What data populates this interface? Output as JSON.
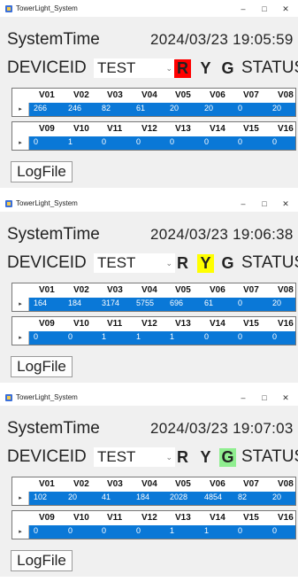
{
  "colors": {
    "red_on": "#ff0000",
    "yellow_on": "#ffff00",
    "green_on": "#90ee90",
    "off": "#f0f0f0",
    "grid_row": "#0a78d7"
  },
  "windows": [
    {
      "title": "TowerLight_System",
      "system_time_label": "SystemTime",
      "system_time_value": "2024/03/23  19:05:59",
      "device_id_label": "DEVICEID",
      "device_id_value": "TEST",
      "lights": {
        "r": "R",
        "y": "Y",
        "g": "G",
        "active": "R"
      },
      "status_label": "STATUS",
      "grid1": {
        "headers": [
          "V01",
          "V02",
          "V03",
          "V04",
          "V05",
          "V06",
          "V07",
          "V08"
        ],
        "values": [
          "266",
          "246",
          "82",
          "61",
          "20",
          "20",
          "0",
          "20"
        ]
      },
      "grid2": {
        "headers": [
          "V09",
          "V10",
          "V11",
          "V12",
          "V13",
          "V14",
          "V15",
          "V16"
        ],
        "values": [
          "0",
          "1",
          "0",
          "0",
          "0",
          "0",
          "0",
          "0"
        ]
      },
      "logfile_label": "LogFile"
    },
    {
      "title": "TowerLight_System",
      "system_time_label": "SystemTime",
      "system_time_value": "2024/03/23  19:06:38",
      "device_id_label": "DEVICEID",
      "device_id_value": "TEST",
      "lights": {
        "r": "R",
        "y": "Y",
        "g": "G",
        "active": "Y"
      },
      "status_label": "STATUS",
      "grid1": {
        "headers": [
          "V01",
          "V02",
          "V03",
          "V04",
          "V05",
          "V06",
          "V07",
          "V08"
        ],
        "values": [
          "164",
          "184",
          "3174",
          "5755",
          "696",
          "61",
          "0",
          "20"
        ]
      },
      "grid2": {
        "headers": [
          "V09",
          "V10",
          "V11",
          "V12",
          "V13",
          "V14",
          "V15",
          "V16"
        ],
        "values": [
          "0",
          "0",
          "1",
          "1",
          "1",
          "0",
          "0",
          "0"
        ]
      },
      "logfile_label": "LogFile"
    },
    {
      "title": "TowerLight_System",
      "system_time_label": "SystemTime",
      "system_time_value": "2024/03/23  19:07:03",
      "device_id_label": "DEVICEID",
      "device_id_value": "TEST",
      "lights": {
        "r": "R",
        "y": "Y",
        "g": "G",
        "active": "G"
      },
      "status_label": "STATUS",
      "grid1": {
        "headers": [
          "V01",
          "V02",
          "V03",
          "V04",
          "V05",
          "V06",
          "V07",
          "V08"
        ],
        "values": [
          "102",
          "20",
          "41",
          "184",
          "2028",
          "4854",
          "82",
          "20"
        ]
      },
      "grid2": {
        "headers": [
          "V09",
          "V10",
          "V11",
          "V12",
          "V13",
          "V14",
          "V15",
          "V16"
        ],
        "values": [
          "0",
          "0",
          "0",
          "0",
          "1",
          "1",
          "0",
          "0"
        ]
      },
      "logfile_label": "LogFile"
    }
  ]
}
